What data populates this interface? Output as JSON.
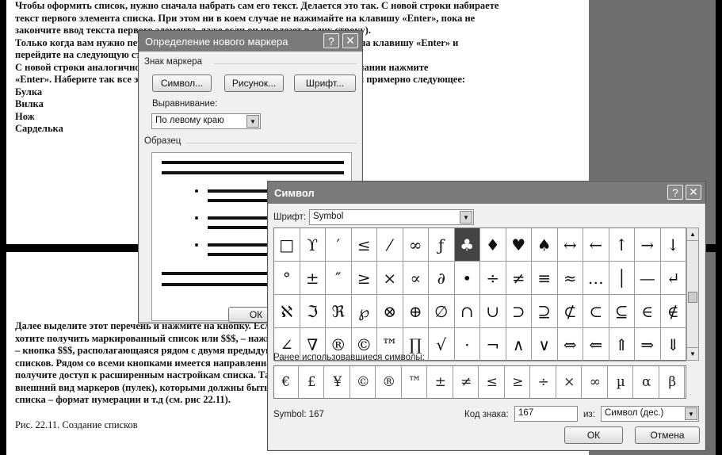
{
  "document": {
    "page1_lines": [
      "Чтобы оформить список, нужно сначала набрать сам его текст. Делается это так. С новой строки набираете",
      "текст первого элемента списка. При этом ни в коем случае не нажимайте на клавишу «Enter», пока не",
      "закончите ввод текста первого элемента, даже если он не влезет в одну строку).",
      "Только когда вам нужно перейти к вводу второго элемента списка, нажмите на клавишу «Enter» и",
      "перейдите на следующую строку.",
      "С новой строки аналогично введите текст второго элемента списка. По окончании нажмите",
      "«Enter». Наберите так все элементы списка. В итоге у вас должно получиться примерно следующее:",
      "Булка",
      "Вилка",
      "Нож",
      "Сарделька"
    ],
    "page2_lines": [
      "Далее выделите этот перечень и нажмите на кнопку. Если вы",
      "хотите получить маркированный список или $$$, – нажмите",
      "– кнопка $$$, располагающаяся рядом с двумя предыдущими кнопками",
      "списков. Рядом со всеми кнопками имеется направленная вниз стрелка, нажав на которую, вы",
      "получите доступ к расширенным настройкам списка. Так, вы сможете выбрать",
      "внешний вид маркеров (пулек), которыми должны быть помечены элементы",
      "списка – формат нумерации и т.д (см. рис 22.11)."
    ],
    "caption": "Рис. 22.11. Создание списков"
  },
  "marker_dialog": {
    "title": "Определение нового маркера",
    "help_btn": "?",
    "close_btn": "✕",
    "group_marker": "Знак маркера",
    "btn_symbol": "Символ...",
    "btn_picture": "Рисунок...",
    "btn_font": "Шрифт...",
    "align_label": "Выравнивание:",
    "align_value": "По левому краю",
    "group_sample": "Образец",
    "ok": "ОК"
  },
  "symbol_dialog": {
    "title": "Символ",
    "help_btn": "?",
    "close_btn": "✕",
    "font_label": "Шрифт:",
    "font_value": "Symbol",
    "symbols": [
      "□",
      "ϒ",
      "′",
      "≤",
      "⁄",
      "∞",
      "ƒ",
      "♣",
      "♦",
      "♥",
      "♠",
      "↔",
      "←",
      "↑",
      "→",
      "↓",
      "°",
      "±",
      "″",
      "≥",
      "×",
      "∝",
      "∂",
      "•",
      "÷",
      "≠",
      "≡",
      "≈",
      "…",
      "│",
      "—",
      "↵",
      "ℵ",
      "ℑ",
      "ℜ",
      "℘",
      "⊗",
      "⊕",
      "∅",
      "∩",
      "∪",
      "⊃",
      "⊇",
      "⊄",
      "⊂",
      "⊆",
      "∈",
      "∉",
      "∠",
      "∇",
      "®",
      "©",
      "™",
      "∏",
      "√",
      "⋅",
      "¬",
      "∧",
      "∨",
      "⇔",
      "⇐",
      "⇑",
      "⇒",
      "⇓"
    ],
    "selected_index": 7,
    "recent_label": "Ранее использовавшиеся символы:",
    "recent": [
      "€",
      "£",
      "¥",
      "©",
      "®",
      "™",
      "±",
      "≠",
      "≤",
      "≥",
      "÷",
      "×",
      "∞",
      "µ",
      "α",
      "β"
    ],
    "status": "Symbol: 167",
    "code_label": "Код знака:",
    "code_value": "167",
    "from_label": "из:",
    "from_value": "Символ (дес.)",
    "ok": "ОК",
    "cancel": "Отмена"
  }
}
